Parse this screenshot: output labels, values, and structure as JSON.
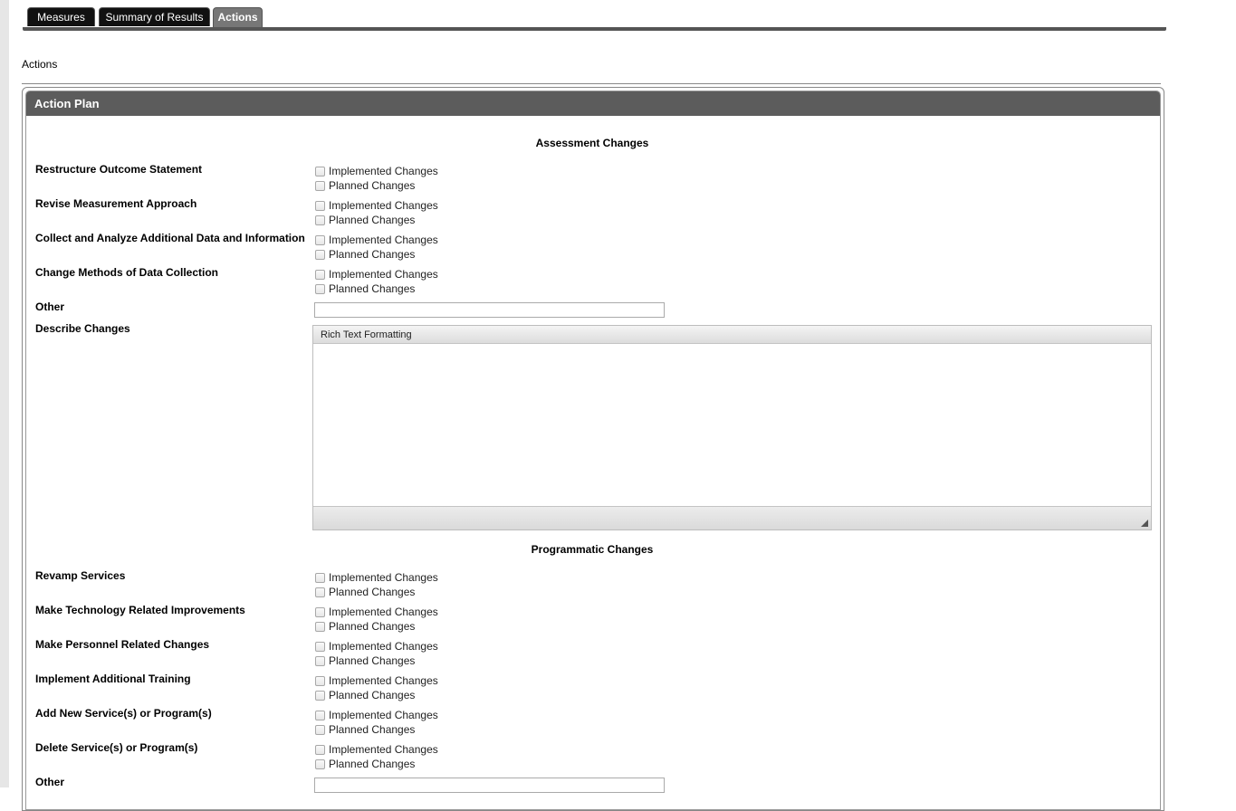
{
  "tabs": [
    {
      "label": "Measures"
    },
    {
      "label": "Summary of Results"
    },
    {
      "label": "Actions"
    }
  ],
  "section_label": "Actions",
  "panel": {
    "title": "Action Plan"
  },
  "checkbox_options": {
    "implemented": "Implemented Changes",
    "planned": "Planned Changes"
  },
  "assessment": {
    "heading": "Assessment Changes",
    "items": [
      {
        "label": "Restructure Outcome Statement"
      },
      {
        "label": "Revise Measurement Approach"
      },
      {
        "label": "Collect and Analyze Additional Data and Information"
      },
      {
        "label": "Change Methods of Data Collection"
      }
    ],
    "other_label": "Other",
    "other_value": "",
    "describe_label": "Describe Changes",
    "editor_toolbar_label": "Rich Text Formatting"
  },
  "programmatic": {
    "heading": "Programmatic Changes",
    "items": [
      {
        "label": "Revamp Services"
      },
      {
        "label": "Make Technology Related Improvements"
      },
      {
        "label": "Make Personnel Related Changes"
      },
      {
        "label": "Implement Additional Training"
      },
      {
        "label": "Add New Service(s) or Program(s)"
      },
      {
        "label": "Delete Service(s) or Program(s)"
      }
    ],
    "other_label": "Other",
    "other_value": ""
  }
}
